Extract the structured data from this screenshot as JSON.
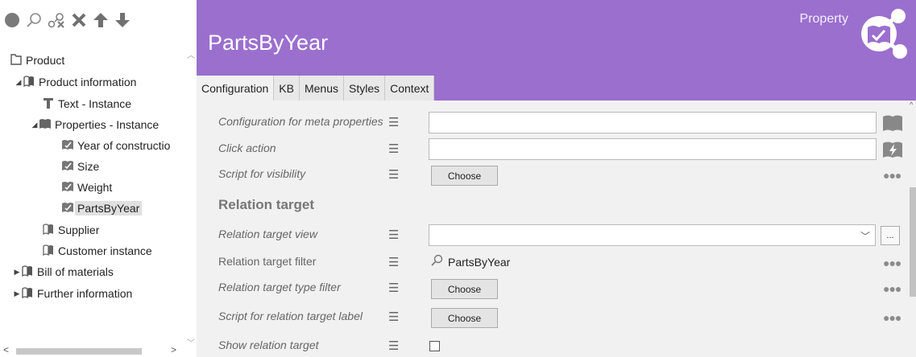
{
  "toolbar": {
    "icons": [
      "circle-icon",
      "search-icon",
      "search-fields-icon",
      "delete-icon",
      "move-up-icon",
      "move-down-icon"
    ]
  },
  "tree": {
    "items": [
      {
        "label": "Product",
        "icon": "folder-outline-icon",
        "level": 0,
        "arrow": ""
      },
      {
        "label": "Product information",
        "icon": "book-icon",
        "level": 1,
        "arrow": "expanded"
      },
      {
        "label": "Text - Instance",
        "icon": "text-t-icon",
        "level": 2,
        "arrow": ""
      },
      {
        "label": "Properties - Instance",
        "icon": "book-filled-icon",
        "level": 2,
        "arrow": "expanded"
      },
      {
        "label": "Year of constructio",
        "icon": "property-icon",
        "level": 3,
        "arrow": ""
      },
      {
        "label": "Size",
        "icon": "property-icon",
        "level": 3,
        "arrow": ""
      },
      {
        "label": "Weight",
        "icon": "property-icon",
        "level": 3,
        "arrow": ""
      },
      {
        "label": "PartsByYear",
        "icon": "property-icon",
        "level": 3,
        "arrow": "",
        "selected": true
      },
      {
        "label": "Supplier",
        "icon": "book-icon",
        "level": 2,
        "arrow": ""
      },
      {
        "label": "Customer instance",
        "icon": "book-icon",
        "level": 2,
        "arrow": ""
      },
      {
        "label": "Bill of materials",
        "icon": "book-icon",
        "level": 1,
        "arrow": "collapsed"
      },
      {
        "label": "Further information",
        "icon": "book-icon",
        "level": 1,
        "arrow": "collapsed"
      }
    ]
  },
  "header": {
    "title": "PartsByYear",
    "type_label": "Property",
    "logo_icon": "property-share-icon",
    "color": "#9b6fce"
  },
  "tabs": [
    {
      "label": "Configuration",
      "active": true
    },
    {
      "label": "KB"
    },
    {
      "label": "Menus"
    },
    {
      "label": "Styles"
    },
    {
      "label": "Context"
    }
  ],
  "form": {
    "rows": {
      "meta": {
        "label": "Configuration for meta properties",
        "value": "",
        "side_icon": "book-icon"
      },
      "click": {
        "label": "Click action",
        "value": "",
        "side_icon": "action-icon"
      },
      "visibility": {
        "label": "Script for visibility",
        "button": "Choose"
      },
      "section": {
        "label": "Relation target"
      },
      "view": {
        "label": "Relation target view",
        "value": "",
        "ellipsis": "..."
      },
      "filter": {
        "label": "Relation target filter",
        "value": "PartsByYear"
      },
      "type_filter": {
        "label": "Relation target type filter",
        "button": "Choose"
      },
      "target_label": {
        "label": "Script for relation target label",
        "button": "Choose"
      },
      "show_target": {
        "label": "Show relation target",
        "checked": false
      }
    }
  }
}
